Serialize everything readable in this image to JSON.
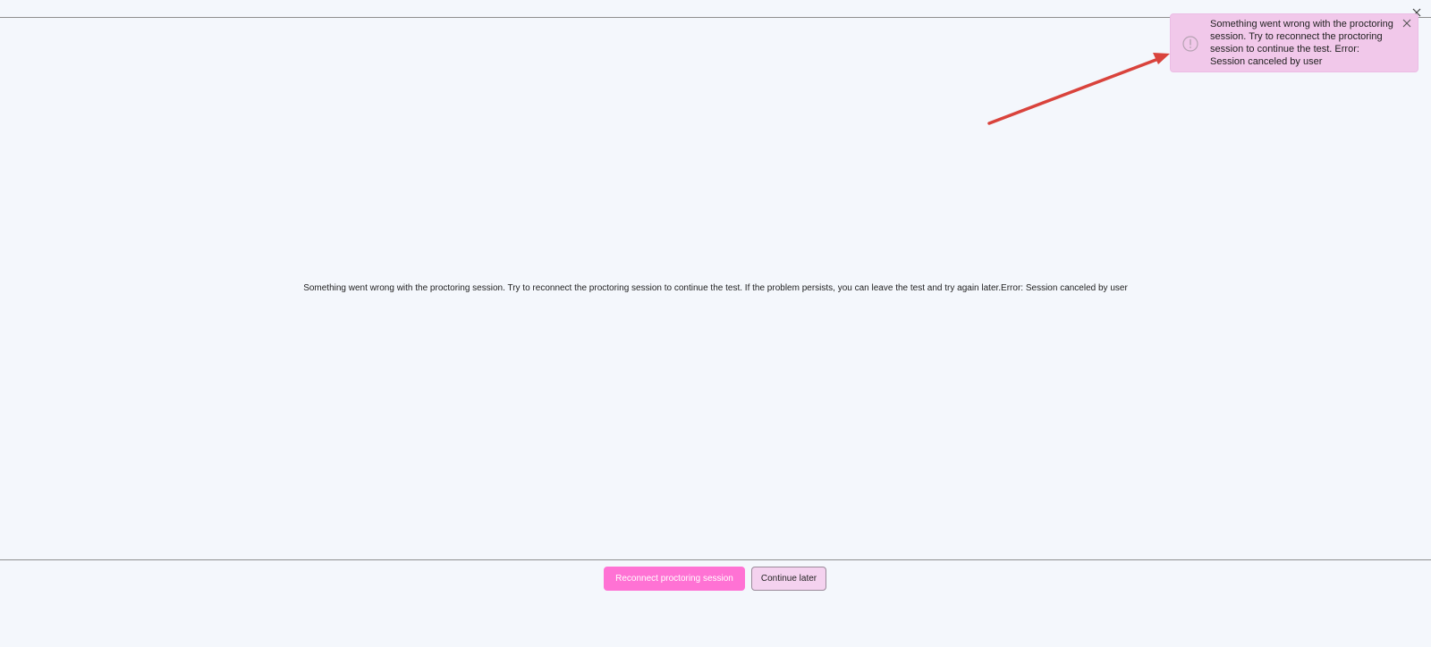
{
  "main": {
    "message": "Something went wrong with the proctoring session. Try to reconnect the proctoring session to continue the test. If the problem persists, you can leave the test and try again later.Error: Session canceled by user"
  },
  "actions": {
    "reconnect_label": "Reconnect proctoring session",
    "continue_later_label": "Continue later"
  },
  "toast": {
    "message": "Something went wrong with the proctoring session. Try to reconnect the proctoring session to continue the test. Error: Session canceled by user",
    "icon": "alert-circle-icon"
  },
  "icons": {
    "window_close": "close-icon",
    "toast_close": "close-icon"
  },
  "colors": {
    "background": "#f4f7fc",
    "primary_button": "#ff72d4",
    "secondary_button": "#f4d2ef",
    "toast_background": "#f1c8ea",
    "annotation_arrow": "#d9433c"
  }
}
